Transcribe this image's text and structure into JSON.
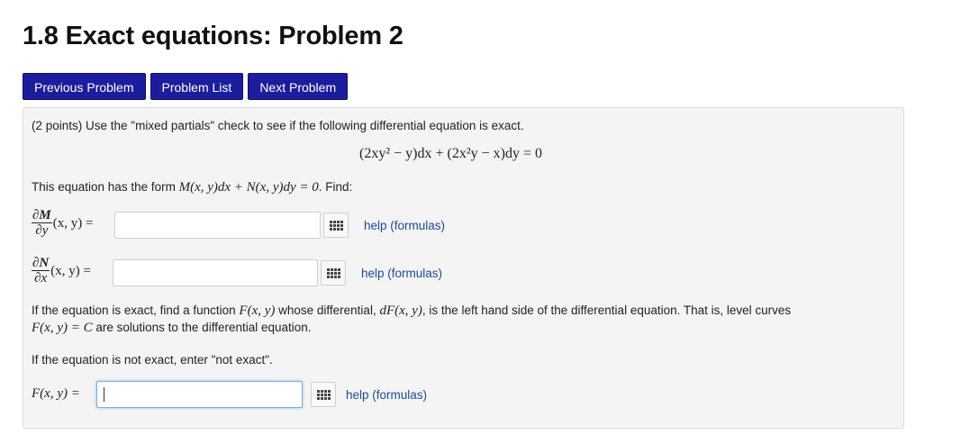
{
  "page": {
    "title": "1.8 Exact equations: Problem 2"
  },
  "nav": {
    "previous": "Previous Problem",
    "list": "Problem List",
    "next": "Next Problem"
  },
  "problem": {
    "intro": "(2 points) Use the \"mixed partials\" check to see if the following differential equation is exact.",
    "equation": "(2xy² − y)dx + (2x²y − x)dy = 0",
    "form_prefix": "This equation has the form ",
    "form_math": "M(x, y)dx + N(x, y)dy = 0",
    "form_suffix": ". Find:",
    "partial_M": {
      "num": "∂M",
      "den": "∂y",
      "args": "(x, y) ="
    },
    "partial_N": {
      "num": "∂N",
      "den": "∂x",
      "args": "(x, y) ="
    },
    "exact_text_1a": "If the equation is exact, find a function ",
    "exact_math_F": "F(x, y)",
    "exact_text_1b": " whose differential, ",
    "exact_math_dF": "dF(x, y)",
    "exact_text_1c": ", is the left hand side of the differential equation. That is, level curves",
    "exact_math_level": "F(x, y) = C",
    "exact_text_2": " are solutions to the differential equation.",
    "not_exact_text": "If the equation is not exact, enter \"not exact\".",
    "F_label": "F(x, y) ="
  },
  "inputs": {
    "answer1": "",
    "answer2": "",
    "answer3": ""
  },
  "help_label": "help (formulas)",
  "icons": {
    "palette": "equation-palette-icon"
  },
  "colors": {
    "nav_button": "#1c1d9e",
    "help_link": "#1a4a9a",
    "focus_border": "#7ab0e0"
  }
}
